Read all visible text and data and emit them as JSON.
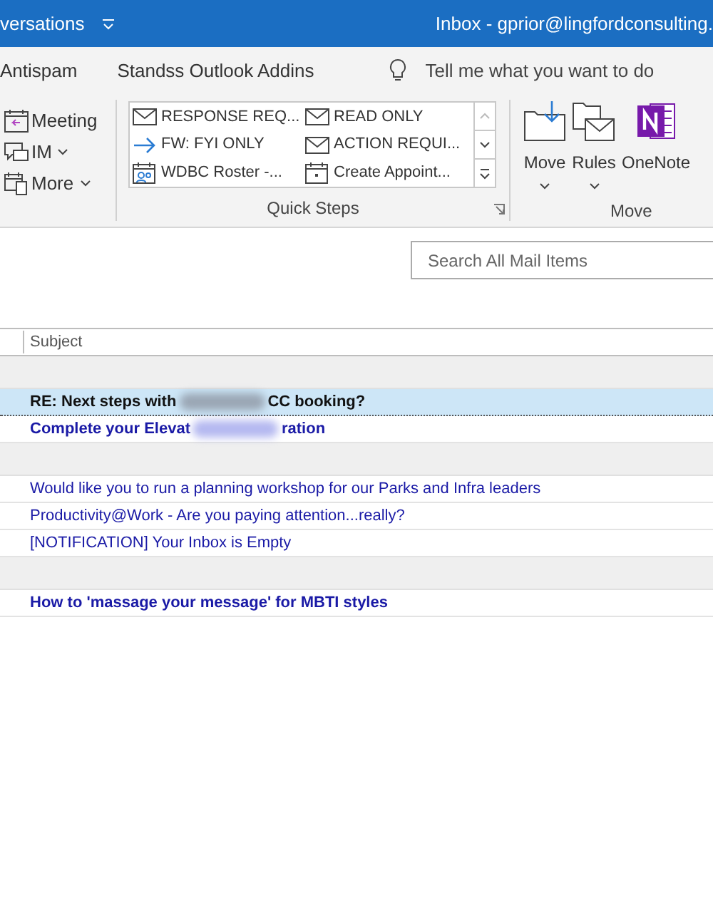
{
  "title_bar": {
    "left_text": "versations",
    "title": "Inbox - gprior@lingfordconsulting."
  },
  "ribbon_tabs": [
    {
      "label": "Antispam"
    },
    {
      "label": "Standss Outlook Addins"
    }
  ],
  "tell_me": {
    "placeholder": "Tell me what you want to do"
  },
  "respond_group": [
    {
      "label": "Meeting",
      "dropdown": false
    },
    {
      "label": "IM",
      "dropdown": true
    },
    {
      "label": "More",
      "dropdown": true
    }
  ],
  "quick_steps": {
    "label": "Quick Steps",
    "items": [
      {
        "label": "RESPONSE REQ..."
      },
      {
        "label": "FW: FYI ONLY"
      },
      {
        "label": "WDBC Roster -..."
      },
      {
        "label": "READ ONLY"
      },
      {
        "label": "ACTION REQUI..."
      },
      {
        "label": "Create Appoint..."
      }
    ]
  },
  "move_group": {
    "label": "Move",
    "buttons": [
      {
        "label": "Move",
        "dropdown": true
      },
      {
        "label": "Rules",
        "dropdown": true
      },
      {
        "label": "OneNote",
        "dropdown": false
      }
    ]
  },
  "search": {
    "placeholder": "Search All Mail Items"
  },
  "table": {
    "columns": [
      {
        "label": "Subject"
      }
    ],
    "rows": [
      {
        "kind": "group"
      },
      {
        "kind": "mail",
        "subject": "RE: Next steps with",
        "subject_after_blur": "CC booking?",
        "blurred": true,
        "unread": true,
        "selected": true
      },
      {
        "kind": "mail",
        "subject": "Complete your Elevat",
        "subject_after_blur": "ration",
        "blurred": true,
        "unread": true,
        "selected": false
      },
      {
        "kind": "group"
      },
      {
        "kind": "mail",
        "subject": "Would like you to run a planning workshop for our Parks and Infra leaders",
        "blurred": false,
        "unread": false,
        "selected": false
      },
      {
        "kind": "mail",
        "subject": "Productivity@Work - Are you paying attention...really?",
        "blurred": false,
        "unread": false,
        "selected": false
      },
      {
        "kind": "mail",
        "subject": "[NOTIFICATION] Your Inbox is Empty",
        "blurred": false,
        "unread": false,
        "selected": false
      },
      {
        "kind": "group"
      },
      {
        "kind": "mail",
        "subject": "How to 'massage your message' for MBTI styles",
        "blurred": false,
        "unread": true,
        "selected": false
      }
    ]
  }
}
